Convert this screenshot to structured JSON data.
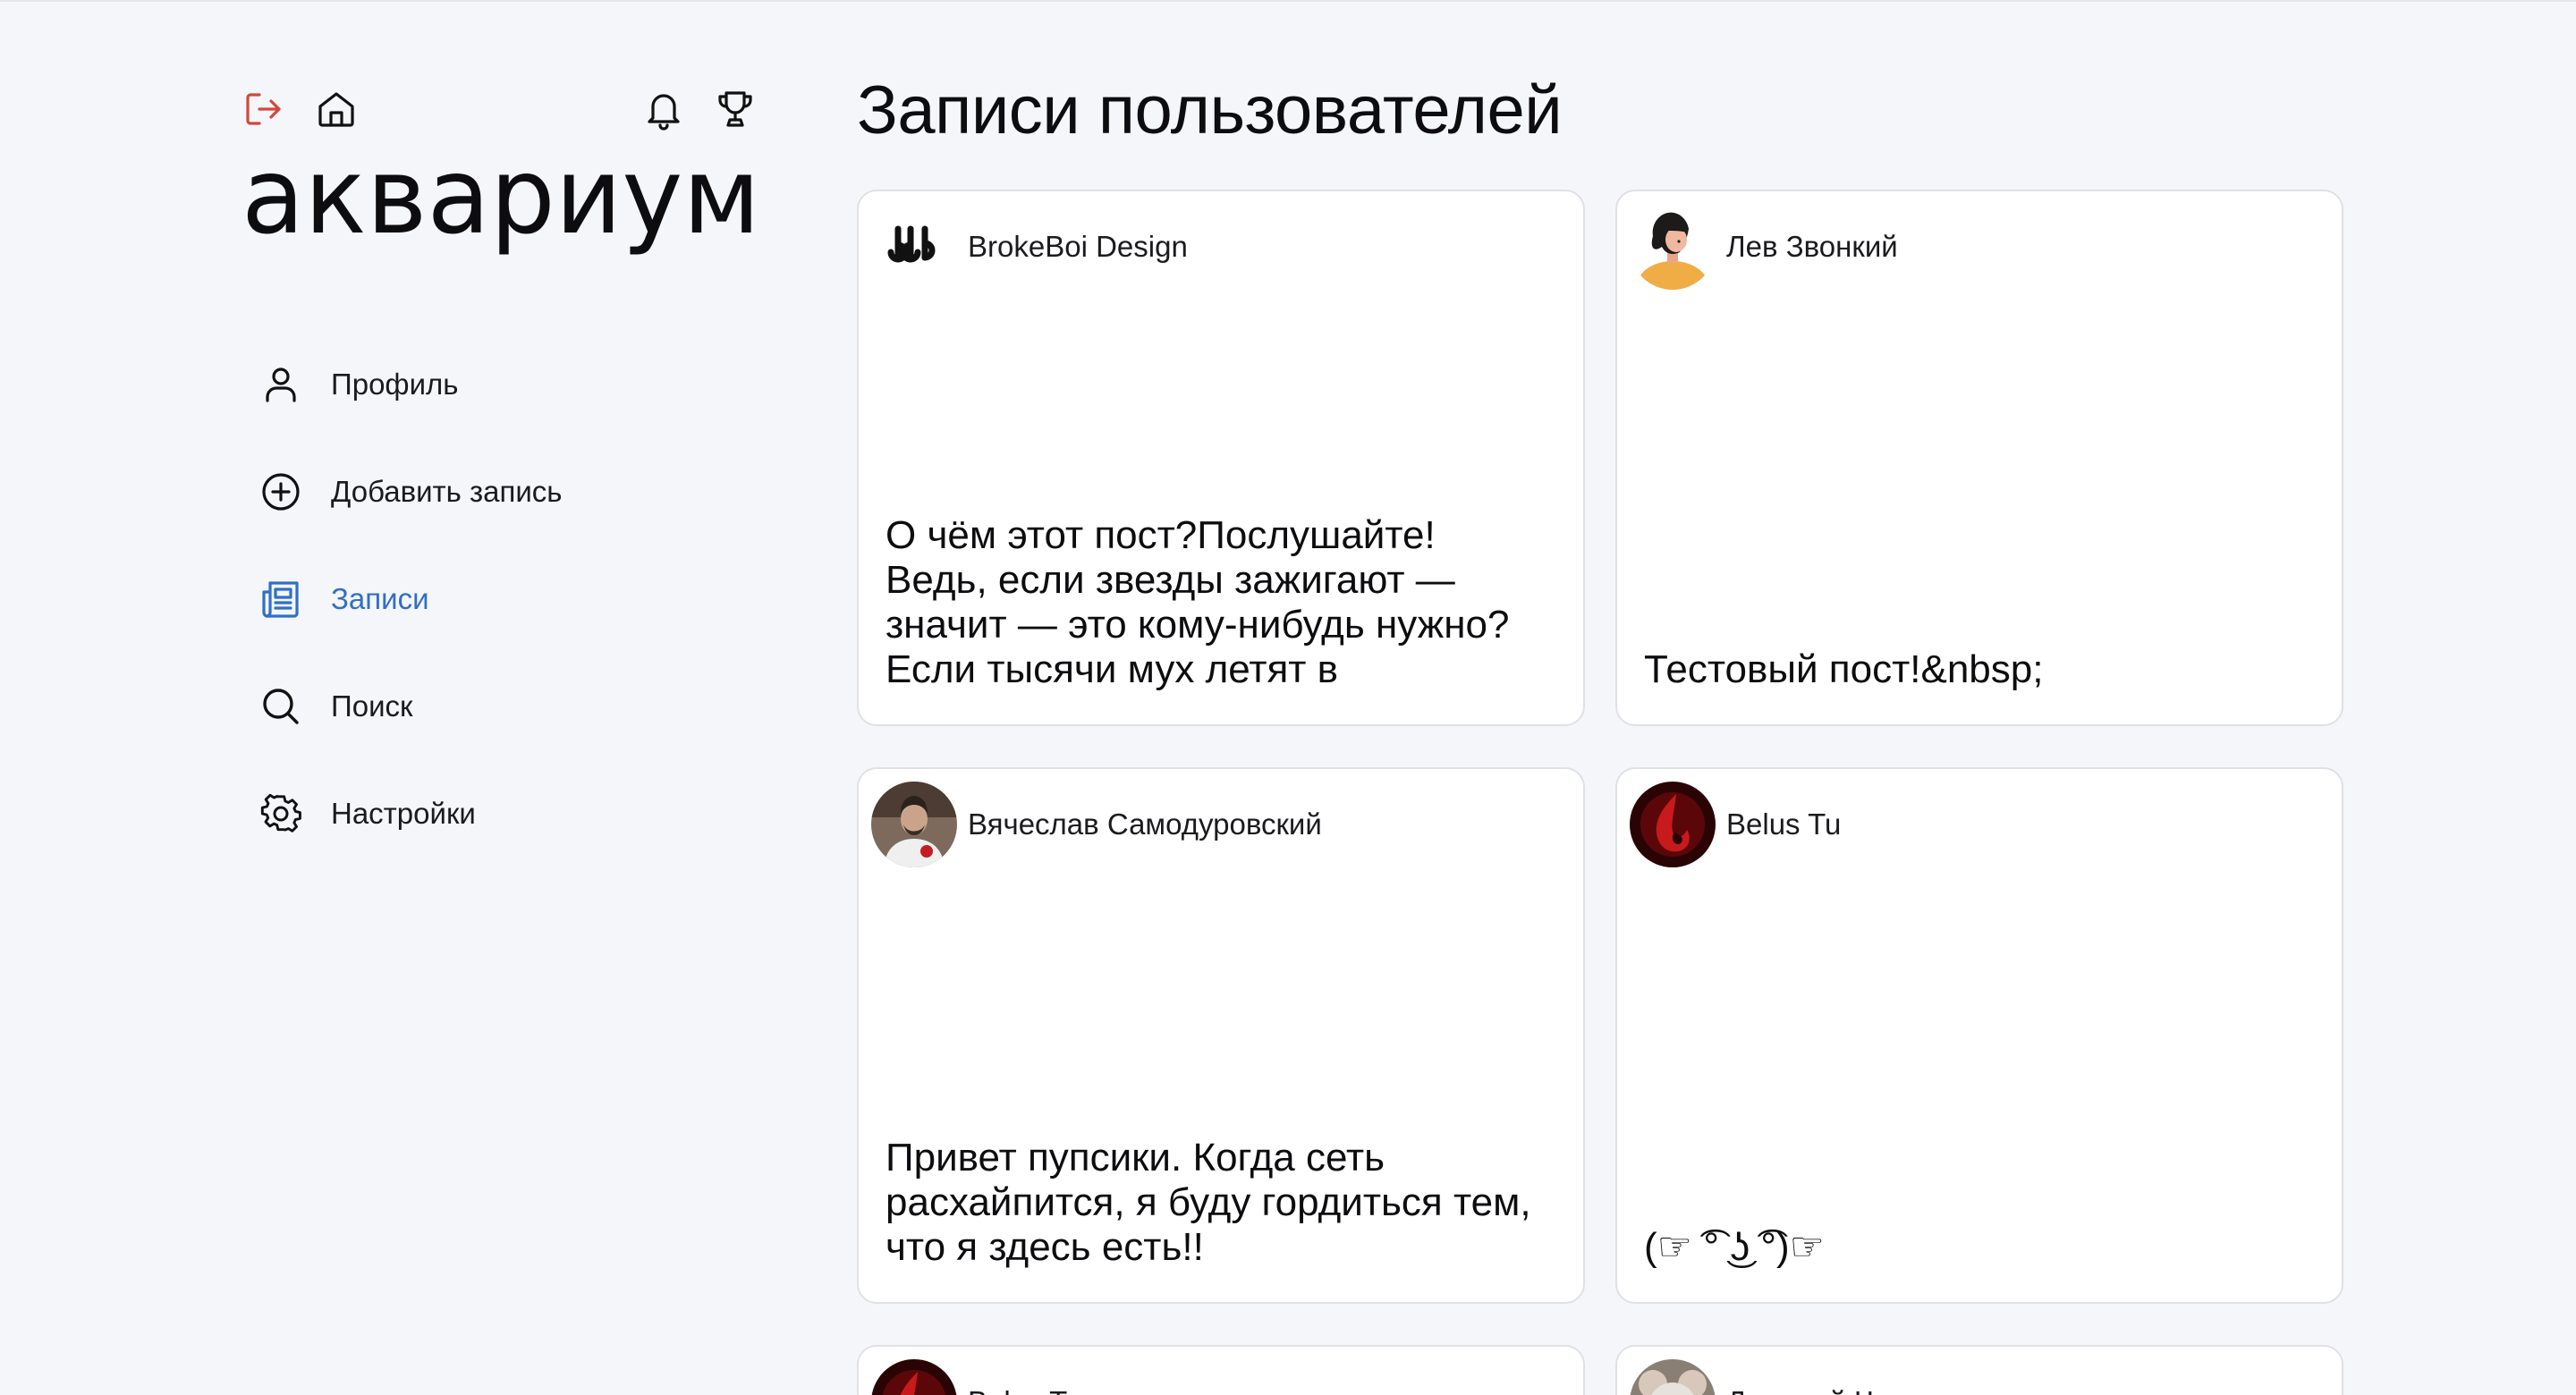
{
  "header": {
    "logout_icon": "logout-icon",
    "home_icon": "home-icon",
    "bell_icon": "bell-icon",
    "trophy_icon": "trophy-icon"
  },
  "logo": {
    "text": "аквариум"
  },
  "sidebar": {
    "items": [
      {
        "label": "Профиль",
        "icon": "user-icon",
        "active": false
      },
      {
        "label": "Добавить запись",
        "icon": "plus-circle-icon",
        "active": false
      },
      {
        "label": "Записи",
        "icon": "newspaper-icon",
        "active": true
      },
      {
        "label": "Поиск",
        "icon": "search-icon",
        "active": false
      },
      {
        "label": "Настройки",
        "icon": "gear-icon",
        "active": false
      }
    ]
  },
  "main": {
    "title": "Записи пользователей",
    "posts": [
      {
        "author": "BrokeBoi Design",
        "text": "О чём этот пост?Послушайте! Ведь, если звезды зажигают — значит — это кому-нибудь нужно?Если тысячи мух летят в"
      },
      {
        "author": "Лев Звонкий",
        "text": "Тестовый пост!&nbsp;"
      },
      {
        "author": "Вячеслав Самодуровский",
        "text": "Привет пупсики. Когда сеть расхайпится, я буду гордиться тем, что я здесь есть!!"
      },
      {
        "author": "Belus Tu",
        "text": "(☞ ͡° ͜ʖ ͡°)☞"
      },
      {
        "author": "Belus Tu",
        "text": ""
      },
      {
        "author": "Дмитрий Чепков",
        "text": ""
      }
    ]
  },
  "colors": {
    "background": "#f5f6f9",
    "accent": "#2f6fc9",
    "logout": "#d6453d",
    "card_border": "#dfe1e5"
  }
}
